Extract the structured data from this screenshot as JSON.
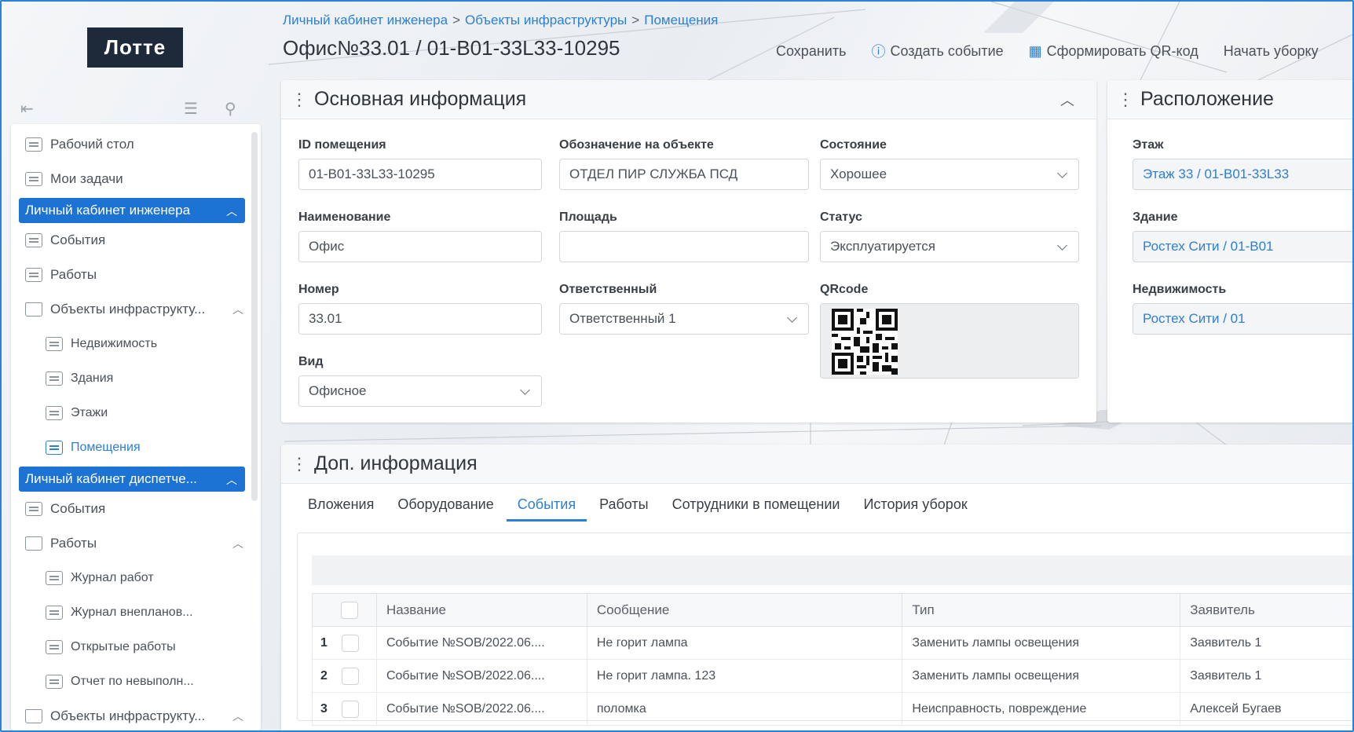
{
  "logo": "Лотте",
  "breadcrumb": [
    "Личный кабинет инженера",
    "Объекты инфраструктуры",
    "Помещения"
  ],
  "breadcrumb_sep": ">",
  "page_title": "Офис№33.01 / 01-B01-33L33-10295",
  "toolbar": {
    "save": "Сохранить",
    "create_event": "Создать событие",
    "qr": "Сформировать QR-код",
    "start_cleaning": "Начать уборку"
  },
  "sidebar": {
    "desktop": "Рабочий стол",
    "my_tasks": "Мои задачи",
    "group_engineer": "Личный кабинет инженера",
    "events": "События",
    "works": "Работы",
    "infra": "Объекты инфраструкту...",
    "realty": "Недвижимость",
    "buildings": "Здания",
    "floors": "Этажи",
    "rooms": "Помещения",
    "group_dispatcher": "Личный кабинет диспетче...",
    "events2": "События",
    "works2": "Работы",
    "work_log": "Журнал работ",
    "unplanned_log": "Журнал внепланов...",
    "open_works": "Открытые работы",
    "report_failed": "Отчет по невыполн...",
    "infra2": "Объекты инфраструкту..."
  },
  "main_info": {
    "title": "Основная информация",
    "id_label": "ID помещения",
    "id_value": "01-B01-33L33-10295",
    "designation_label": "Обозначение на объекте",
    "designation_value": "ОТДЕЛ ПИР СЛУЖБА ПСД",
    "condition_label": "Состояние",
    "condition_value": "Хорошее",
    "name_label": "Наименование",
    "name_value": "Офис",
    "area_label": "Площадь",
    "area_value": "",
    "status_label": "Статус",
    "status_value": "Эксплуатируется",
    "number_label": "Номер",
    "number_value": "33.01",
    "responsible_label": "Ответственный",
    "responsible_value": "Ответственный 1",
    "qr_label": "QRcode",
    "kind_label": "Вид",
    "kind_value": "Офисное"
  },
  "location": {
    "title": "Расположение",
    "floor_label": "Этаж",
    "floor_value": "Этаж 33 / 01-B01-33L33",
    "building_label": "Здание",
    "building_value": "Ростех Сити / 01-B01",
    "realty_label": "Недвижимость",
    "realty_value": "Ростех Сити / 01"
  },
  "extra": {
    "title": "Доп. информация",
    "tabs": [
      "Вложения",
      "Оборудование",
      "События",
      "Работы",
      "Сотрудники в помещении",
      "История уборок"
    ],
    "active_tab": "События",
    "columns": [
      "Название",
      "Сообщение",
      "Тип",
      "Заявитель"
    ],
    "rows": [
      {
        "num": "1",
        "name": "Событие №SOB/2022.06....",
        "message": "Не горит лампа",
        "type": "Заменить лампы освещения",
        "applicant": "Заявитель 1"
      },
      {
        "num": "2",
        "name": "Событие №SOB/2022.06....",
        "message": "Не горит лампа. 123",
        "type": "Заменить лампы освещения",
        "applicant": "Заявитель 1"
      },
      {
        "num": "3",
        "name": "Событие №SOB/2022.06....",
        "message": "поломка",
        "type": "Неисправность, повреждение",
        "applicant": "Алексей Бугаев"
      }
    ]
  },
  "colors": {
    "accent": "#1d73d3",
    "link": "#2b7fd6",
    "logo_bg": "#1d2a3a"
  }
}
